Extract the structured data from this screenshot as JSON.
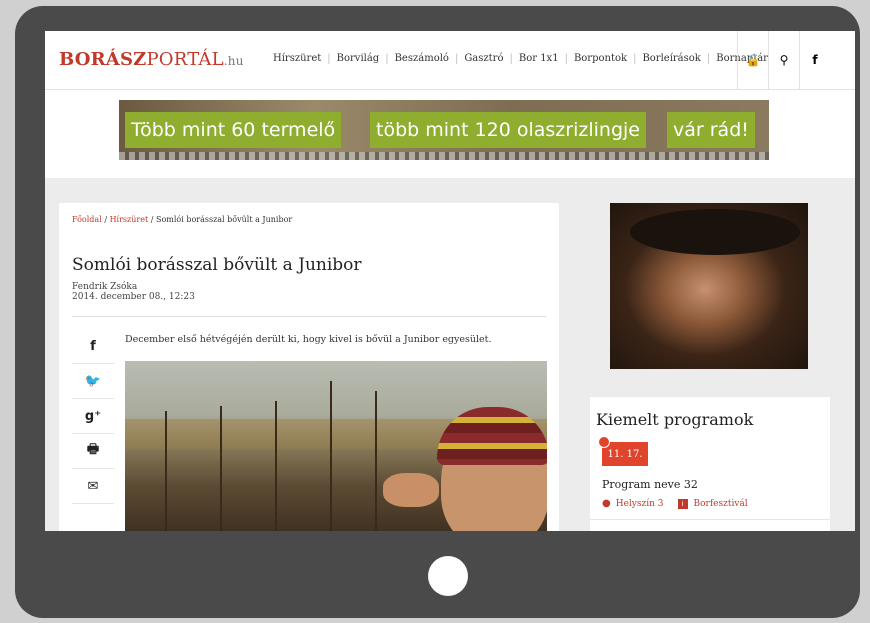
{
  "header": {
    "logo": {
      "part1": "BORÁSZ",
      "part2": "PORTÁL",
      "part3": ".hu"
    },
    "nav": [
      "Hírszüret",
      "Borvilág",
      "Beszámoló",
      "Gasztró",
      "Bor 1x1",
      "Borpontok",
      "Borleírások",
      "Bornaptár"
    ],
    "icons": [
      {
        "name": "lock-icon",
        "glyph": "🔒"
      },
      {
        "name": "search-icon",
        "glyph": "⚲"
      },
      {
        "name": "facebook-icon",
        "glyph": "f"
      }
    ]
  },
  "banner": {
    "texts": [
      "Több mint 60 termelő",
      "több mint 120 olaszrizlingje",
      "vár rád!"
    ]
  },
  "article": {
    "breadcrumb": {
      "home": "Főoldal",
      "section": "Hírszüret",
      "current": "Somlói borásszal bővült a Junibor"
    },
    "breadcrumb_sep": "/",
    "title": "Somlói borásszal bővült a Junibor",
    "author": "Fendrik Zsóka",
    "date": "2014. december 08., 12:23",
    "lead": "December első hétvégéjén derült ki, hogy kivel is bővül a Junibor egyesület.",
    "share": [
      {
        "name": "facebook-share-icon",
        "glyph": "f"
      },
      {
        "name": "twitter-share-icon",
        "glyph": "🐦"
      },
      {
        "name": "googleplus-share-icon",
        "glyph": "g⁺"
      },
      {
        "name": "print-icon",
        "glyph": "🖶"
      },
      {
        "name": "email-icon",
        "glyph": "✉"
      }
    ]
  },
  "sidebar": {
    "programs_heading": "Kiemelt programok",
    "program": {
      "date": "11. 17.",
      "name": "Program neve 32",
      "location": "Helyszín 3",
      "category": "Borfesztivál"
    }
  },
  "colors": {
    "brand": "#c0392b",
    "banner_green": "#8fae2f",
    "badge": "#e0442c"
  }
}
